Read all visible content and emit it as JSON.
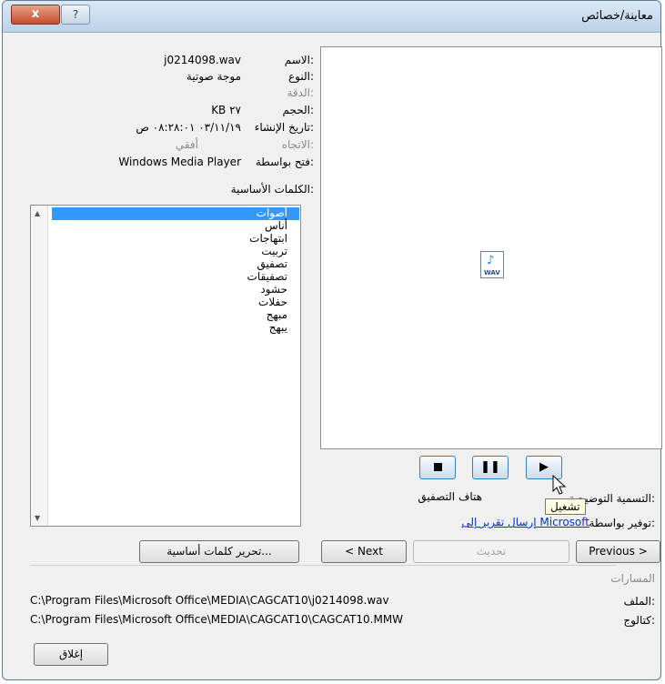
{
  "window": {
    "title": "معاينة/خصائص",
    "close_label": "x",
    "help_label": "?"
  },
  "properties": [
    {
      "label": "الاسم:",
      "value": "j0214098.wav",
      "dim": false
    },
    {
      "label": "النوع:",
      "value": "موجة صوتية",
      "dim": false
    },
    {
      "label": "الدقة:",
      "value": "",
      "dim": true
    },
    {
      "label": "الحجم:",
      "value": "KB ٢٧",
      "dim": false
    },
    {
      "label": "تاريخ الإنشاء:",
      "value": "٠٣/١١/١٩ ٠٨:٢٨:٠١ ص",
      "dim": false
    },
    {
      "label": "الاتجاه:",
      "value": "أفقي",
      "dim": true
    },
    {
      "label": "فتح بواسطة:",
      "value": "Windows Media Player",
      "dim": false
    }
  ],
  "keywords": {
    "label": "الكلمات الأساسية:",
    "items": [
      "أصوات",
      "أناس",
      "ابتهاجات",
      "تربيت",
      "تصفيق",
      "تصفيقات",
      "حشود",
      "حفلات",
      "مبهج",
      "يبهج"
    ],
    "selected_index": 0
  },
  "player": {
    "stop_icon": "stop-icon",
    "pause_icon": "pause-icon",
    "play_icon": "play-icon",
    "tooltip": "تشغيل"
  },
  "caption": {
    "label": "التسمية التوضيحية:",
    "value": "هتاف التصفيق"
  },
  "provided_by": {
    "label": "توفير بواسطة:",
    "link": "إرسال تقرير إلى Microsoft"
  },
  "buttons": {
    "edit_keywords": "تحرير كلمات أساسية...",
    "next": "< Next",
    "update": "تحديث",
    "previous": "Previous >",
    "close": "إغلاق"
  },
  "paths": {
    "section_label": "المسارات",
    "file_label": "الملف:",
    "file_value": "C:\\Program Files\\Microsoft Office\\MEDIA\\CAGCAT10\\j0214098.wav",
    "catalog_label": "كتالوج:",
    "catalog_value": "C:\\Program Files\\Microsoft Office\\MEDIA\\CAGCAT10\\CAGCAT10.MMW"
  },
  "colors": {
    "selection": "#3399ff",
    "link": "#0033cc",
    "close_button": "#c84a2e"
  }
}
